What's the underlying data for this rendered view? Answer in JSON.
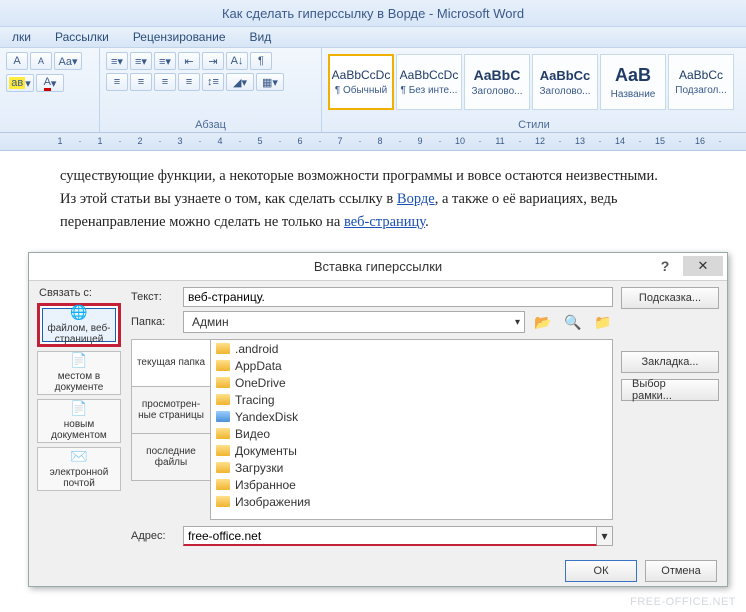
{
  "title": "Как сделать гиперссылку в Ворде - Microsoft Word",
  "ribbon_tabs": {
    "t1": "лки",
    "t2": "Рассылки",
    "t3": "Рецензирование",
    "t4": "Вид"
  },
  "ribbon": {
    "group_paragraph": "Абзац",
    "group_styles": "Стили"
  },
  "styles": [
    {
      "sample": "AaBbCcDc",
      "name": "¶ Обычный"
    },
    {
      "sample": "AaBbCcDc",
      "name": "¶ Без инте..."
    },
    {
      "sample": "AaBbC",
      "name": "Заголово..."
    },
    {
      "sample": "AaBbCc",
      "name": "Заголово..."
    },
    {
      "sample": "AaB",
      "name": "Название"
    },
    {
      "sample": "AaBbCc",
      "name": "Подзагол..."
    }
  ],
  "ruler": [
    "1",
    "·",
    "1",
    "·",
    "2",
    "·",
    "3",
    "·",
    "4",
    "·",
    "5",
    "·",
    "6",
    "·",
    "7",
    "·",
    "8",
    "·",
    "9",
    "·",
    "10",
    "·",
    "11",
    "·",
    "12",
    "·",
    "13",
    "·",
    "14",
    "·",
    "15",
    "·",
    "16",
    "·"
  ],
  "doc": {
    "line1a": "существующие функции, а некоторые  возможности программы и вовсе остаются неизвестными.",
    "line2a": "Из этой статьи вы узнаете о том, как сделать ссылку в ",
    "line2link": "Ворде",
    "line2b": ", а также о её вариациях, ведь",
    "line3a": "перенаправление можно сделать не только на ",
    "line3link": "веб-страницу",
    "line3b": "."
  },
  "dialog": {
    "title": "Вставка гиперссылки",
    "linkto_label": "Связать с:",
    "linkto": [
      {
        "label": "файлом, веб-страницей"
      },
      {
        "label": "местом в документе"
      },
      {
        "label": "новым документом"
      },
      {
        "label": "электронной почтой"
      }
    ],
    "text_label": "Текст:",
    "text_value": "веб-страницу.",
    "screentip": "Подсказка...",
    "folder_label": "Папка:",
    "folder_value": "Админ",
    "bookmark": "Закладка...",
    "targetframe": "Выбор рамки...",
    "browse_tabs": {
      "current": "текущая папка",
      "browsed": "просмотрен-ные страницы",
      "recent": "последние файлы"
    },
    "files": [
      ".android",
      "AppData",
      "OneDrive",
      "Tracing",
      "YandexDisk",
      "Видео",
      "Документы",
      "Загрузки",
      "Избранное",
      "Изображения"
    ],
    "addr_label": "Адрес:",
    "addr_value": "free-office.net",
    "ok": "ОК",
    "cancel": "Отмена"
  },
  "watermark": "FREE-OFFICE.NET"
}
